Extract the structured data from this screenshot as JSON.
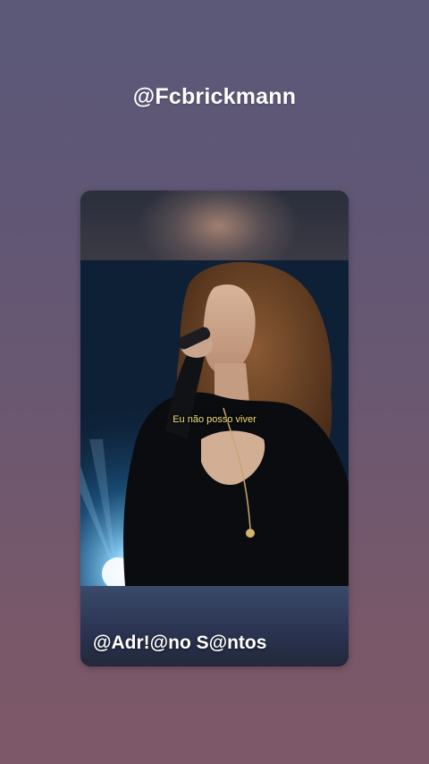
{
  "story": {
    "username": "@Fcbrickmann",
    "video": {
      "caption": "Eu não posso viver",
      "watermark": "@Adr!@no S@ntos"
    }
  }
}
